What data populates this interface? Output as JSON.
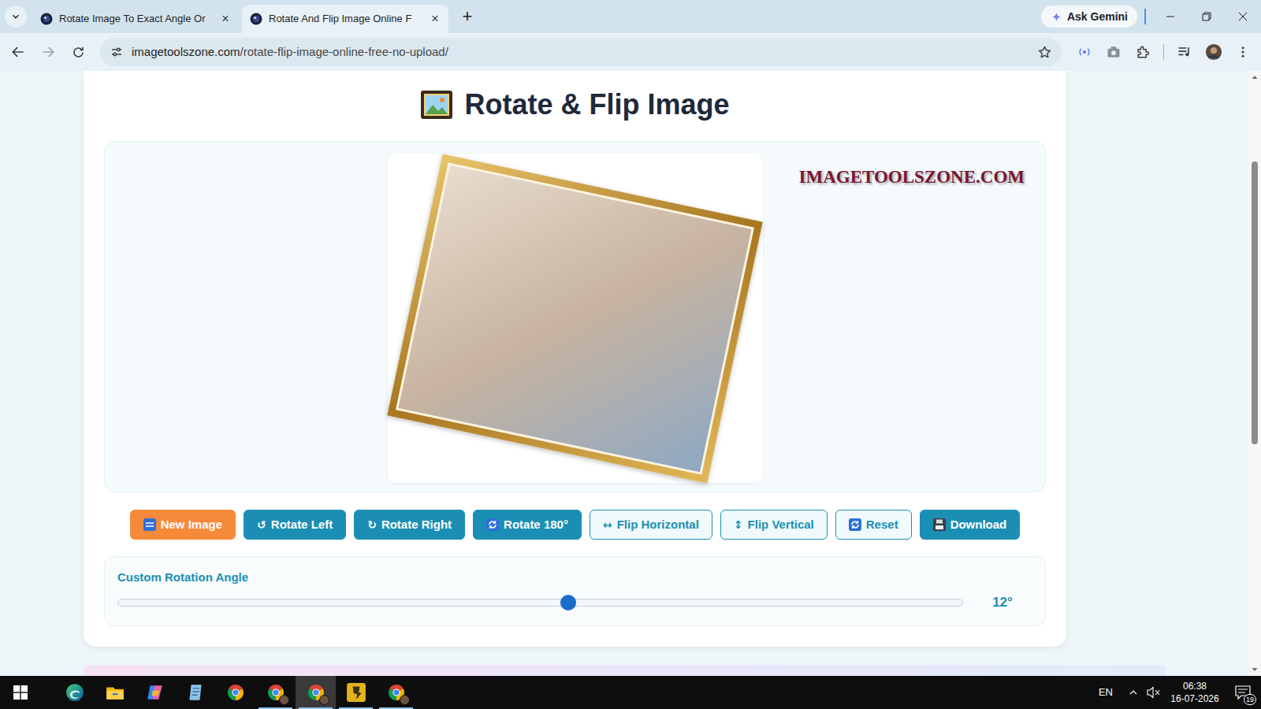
{
  "browser": {
    "tabs": [
      {
        "label": "Rotate Image To Exact Angle Or",
        "close": "×",
        "selected": false
      },
      {
        "label": "Rotate And Flip Image Online F",
        "close": "×",
        "selected": true
      }
    ],
    "new_tab": "+",
    "gemini": "Ask Gemini",
    "address": {
      "domain": "imagetoolszone.com",
      "path": "/rotate-flip-image-online-free-no-upload/"
    }
  },
  "page": {
    "title": "Rotate & Flip Image",
    "watermark": "IMAGETOOLSZONE.COM",
    "buttons": [
      {
        "kind": "new-image",
        "label": "New Image"
      },
      {
        "kind": "rotate",
        "glyph": "↺",
        "label": "Rotate Left"
      },
      {
        "kind": "rotate",
        "glyph": "↻",
        "label": "Rotate Right"
      },
      {
        "kind": "rotate-180",
        "label": "Rotate 180°"
      },
      {
        "kind": "flip",
        "glyph": "↔",
        "label": "Flip Horizontal"
      },
      {
        "kind": "flip",
        "glyph": "↕",
        "label": "Flip Vertical"
      },
      {
        "kind": "reset",
        "label": "Reset"
      },
      {
        "kind": "download",
        "label": "Download"
      }
    ],
    "slider": {
      "label": "Custom Rotation Angle",
      "level": 0.5333,
      "reading": "12°"
    }
  },
  "taskbar": {
    "apps": [
      {
        "kind": "edge",
        "running": false,
        "active": false
      },
      {
        "kind": "explorer",
        "running": false,
        "active": false
      },
      {
        "kind": "copilot",
        "running": false,
        "active": false
      },
      {
        "kind": "notes",
        "running": false,
        "active": false
      },
      {
        "kind": "chrome",
        "running": false,
        "active": false
      },
      {
        "kind": "chrome-profile",
        "running": true,
        "active": false
      },
      {
        "kind": "chrome-profile",
        "running": true,
        "active": true
      },
      {
        "kind": "app-yellow",
        "running": true,
        "active": false
      },
      {
        "kind": "chrome-profile",
        "running": true,
        "active": false
      }
    ],
    "tray": {
      "language": "EN",
      "muted": true,
      "time": "06:38",
      "date": "16-07-2026",
      "notifications": "19"
    }
  }
}
